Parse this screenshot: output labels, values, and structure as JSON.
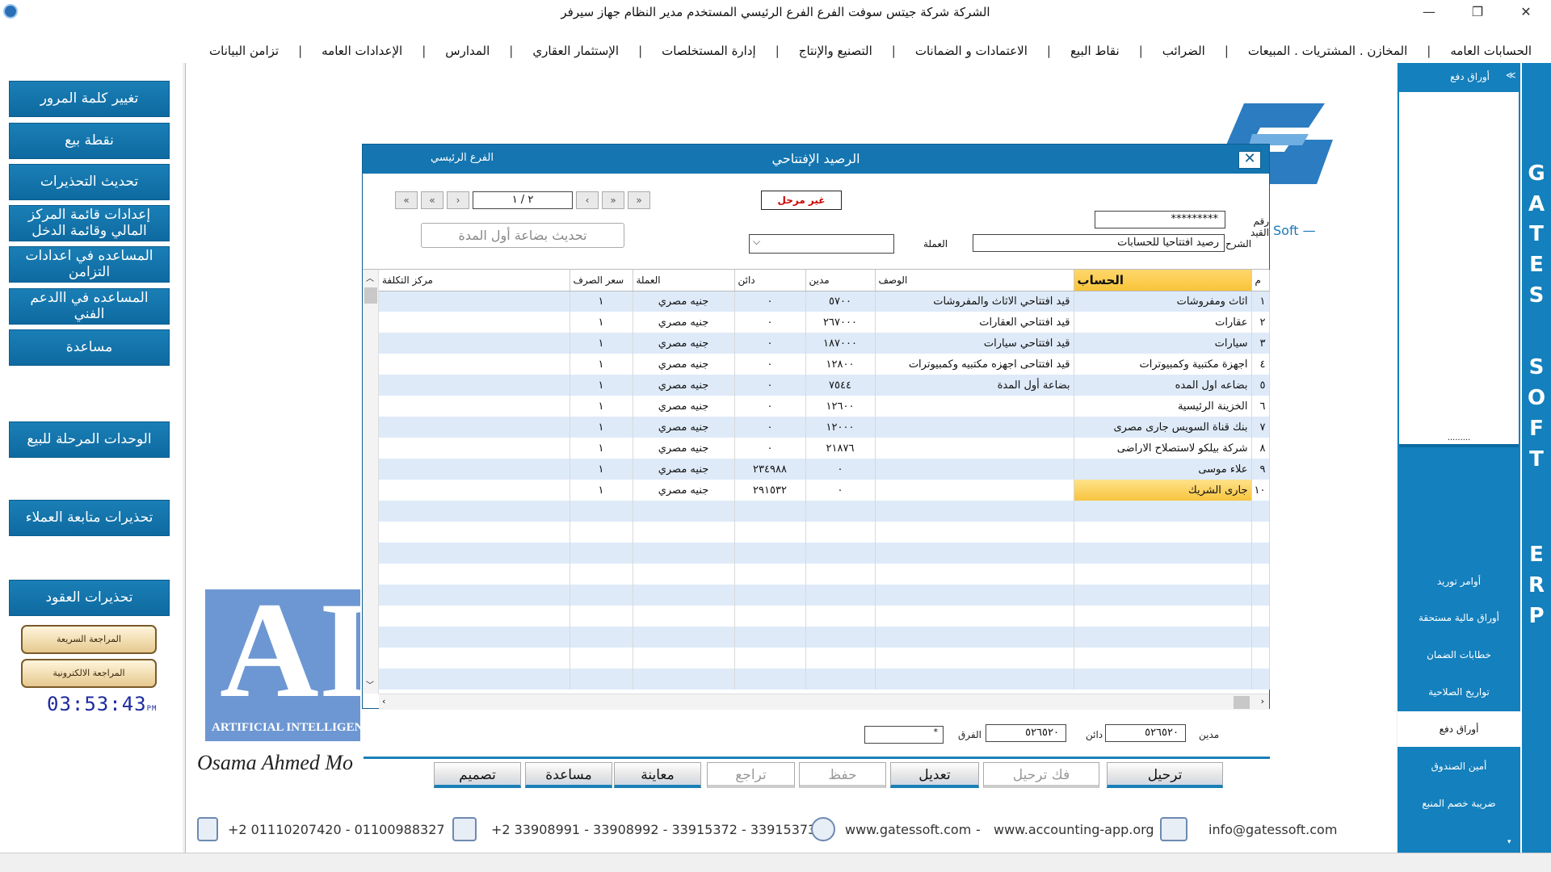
{
  "window": {
    "title": "الشركة شركة جيتس سوفت    الفرع الفرع الرئيسي    المستخدم مدير النظام    جهاز سيرفر",
    "minimize": "—",
    "restore": "❐",
    "close": "✕"
  },
  "menu": [
    "الحسابات العامه",
    "المخازن . المشتريات . المبيعات",
    "الضرائب",
    "نقاط البيع",
    "الاعتمادات و الضمانات",
    "التصنيع والإنتاج",
    "إدارة المستخلصات",
    "الإستثمار العقاري",
    "المدارس",
    "الإعدادات العامه",
    "تزامن البيانات"
  ],
  "left_panel": {
    "buttons": [
      "تغيير كلمة المرور",
      "نقطة بيع",
      "تحديث التحذيرات",
      "إعدادات قائمة المركز المالي وقائمة الدخل",
      "المساعده في اعدادات التزامن",
      "المساعده في االدعم الفني",
      "مساعدة",
      "الوحدات المرحلة للبيع",
      "تحذيرات متابعة العملاء",
      "تحذيرات العقود"
    ],
    "quick_review": "المراجعة السريعة",
    "electronic_review": "المراجعة الالكترونية",
    "clock": "03:53:43",
    "clock_ampm": "PM"
  },
  "branding": {
    "soft": "Soft",
    "ai_letters": "AI",
    "ai_text": "ARTIFICIAL INTELLIGENCE",
    "signature": "Osama Ahmed Mo"
  },
  "dialog": {
    "title": "الرصيد الإفتتاحي",
    "branch": "الفرع الرئيسي",
    "close": "✕",
    "pager": "٢ / ١",
    "pager_first": "«",
    "pager_prev": "‹",
    "pager_next": "›",
    "pager_last": "»",
    "status": "غير مرحل",
    "update_button": "تحديث بضاعة أول المدة",
    "entry_no_label": "رقم القيد",
    "entry_no": "*********",
    "desc_label": "الشرح",
    "desc_value": "رصيد افتتاحيا للحسابات",
    "currency_label": "العملة",
    "columns": [
      "م",
      "الحساب",
      "الوصف",
      "مدين",
      "دائن",
      "العملة",
      "سعر الصرف",
      "مركز التكلفة"
    ],
    "rows": [
      {
        "n": "١",
        "account": "اثاث ومفروشات",
        "desc": "قيد افتتاحي الاثاث والمفروشات",
        "debit": "٥٧٠٠",
        "credit": "٠",
        "currency": "جنيه مصري",
        "rate": "١",
        "cost": ""
      },
      {
        "n": "٢",
        "account": "عقارات",
        "desc": "قيد افتتاحي العقارات",
        "debit": "٢٦٧٠٠٠",
        "credit": "٠",
        "currency": "جنيه مصري",
        "rate": "١",
        "cost": ""
      },
      {
        "n": "٣",
        "account": "سيارات",
        "desc": "قيد افتتاحي سيارات",
        "debit": "١٨٧٠٠٠",
        "credit": "٠",
        "currency": "جنيه مصري",
        "rate": "١",
        "cost": ""
      },
      {
        "n": "٤",
        "account": "اجهزة مكتبية وكمبيوترات",
        "desc": "قيد افتتاحى اجهزه مكتبيه وكمبيوترات",
        "debit": "١٢٨٠٠",
        "credit": "٠",
        "currency": "جنيه مصري",
        "rate": "١",
        "cost": ""
      },
      {
        "n": "٥",
        "account": "بضاعه  اول المده",
        "desc": "بضاعة أول المدة",
        "debit": "٧٥٤٤",
        "credit": "٠",
        "currency": "جنيه مصري",
        "rate": "١",
        "cost": ""
      },
      {
        "n": "٦",
        "account": "الخزينة الرئيسية",
        "desc": "",
        "debit": "١٢٦٠٠",
        "credit": "٠",
        "currency": "جنيه مصري",
        "rate": "١",
        "cost": ""
      },
      {
        "n": "٧",
        "account": "بنك قناة السويس جارى مصرى",
        "desc": "",
        "debit": "١٢٠٠٠",
        "credit": "٠",
        "currency": "جنيه مصري",
        "rate": "١",
        "cost": ""
      },
      {
        "n": "٨",
        "account": "شركة بيلكو لاستصلاح الاراضى",
        "desc": "",
        "debit": "٢١٨٧٦",
        "credit": "٠",
        "currency": "جنيه مصري",
        "rate": "١",
        "cost": ""
      },
      {
        "n": "٩",
        "account": "علاء موسى",
        "desc": "",
        "debit": "٠",
        "credit": "٢٣٤٩٨٨",
        "currency": "جنيه مصري",
        "rate": "١",
        "cost": ""
      },
      {
        "n": "١٠",
        "account": "جارى الشريك",
        "desc": "",
        "debit": "٠",
        "credit": "٢٩١٥٣٢",
        "currency": "جنيه مصري",
        "rate": "١",
        "cost": ""
      }
    ],
    "empty_rows": 9
  },
  "totals": {
    "debit_label": "مدين",
    "debit": "٥٢٦٥٢٠",
    "credit_label": "دائن",
    "credit": "٥٢٦٥٢٠",
    "diff_label": "الفرق",
    "diff": "",
    "diff_extra": "*"
  },
  "actions": [
    "ترحيل",
    "فك ترحيل",
    "تعديل",
    "حفظ",
    "تراجع",
    "معاينة",
    "مساعدة",
    "تصميم"
  ],
  "contacts": {
    "mobile": "+2 01110207420  - 01100988327",
    "phone": "+2 33908991 - 33908992 - 33915372 - 33915373",
    "web1": "www.gatessoft.com",
    "dash": "-",
    "web2": "www.accounting-app.org",
    "email": "info@gatessoft.com"
  },
  "right_panel": {
    "header": "أوراق دفع",
    "collapse": "≪",
    "dots": ".........",
    "items": [
      "أوامر توريد",
      "أوراق مالية مستحقة",
      "خطابات الضمان",
      "تواريخ الصلاحية",
      "أوراق دفع",
      "أمين الصندوق",
      "ضريبة خصم المنبع"
    ],
    "active_item": 4,
    "scroll": "▾"
  },
  "gates_letters": [
    "G",
    "A",
    "T",
    "E",
    "S",
    "S",
    "O",
    "F",
    "T",
    "E",
    "R",
    "P"
  ]
}
